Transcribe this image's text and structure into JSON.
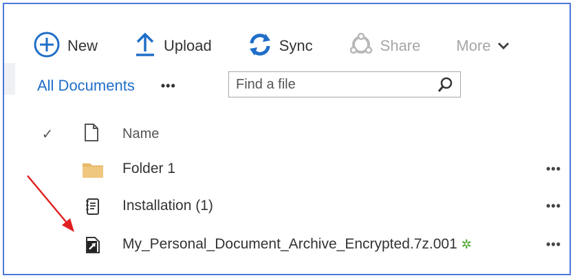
{
  "commandbar": {
    "new_label": "New",
    "upload_label": "Upload",
    "sync_label": "Sync",
    "share_label": "Share",
    "more_label": "More"
  },
  "view": {
    "title": "All Documents",
    "ellipsis": "•••"
  },
  "search": {
    "placeholder": "Find a file"
  },
  "list": {
    "header": {
      "name": "Name"
    },
    "rows": [
      {
        "name": "Folder 1",
        "icon": "folder-icon",
        "more": "•••"
      },
      {
        "name": "Installation (1)",
        "icon": "notebook-icon",
        "more": "•••"
      },
      {
        "name": "My_Personal_Document_Archive_Encrypted.7z.001",
        "icon": "link-file-icon",
        "badge": "✲",
        "more": "•••"
      }
    ]
  },
  "colors": {
    "accent": "#1f6ec8",
    "folder": "#e8b96b",
    "new_badge": "#4aa42a",
    "arrow": "#e02020",
    "frame": "#4a78d8"
  }
}
